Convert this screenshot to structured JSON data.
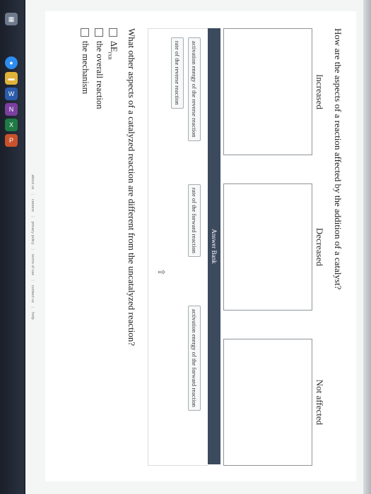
{
  "question1": "How are the aspects of a reaction affected by the addition of a catalyst?",
  "columns": [
    "Increased",
    "Decreased",
    "Not affected"
  ],
  "answer_bank": {
    "title": "Answer Bank",
    "items": [
      "activation energy of the reverse reaction",
      "rate of the forward reaction",
      "activation energy of the forward reaction",
      "rate of the reverse reaction"
    ]
  },
  "question2": "What other aspects of a catalyzed reaction are different from the uncatalyzed reaction?",
  "options": [
    {
      "main": "ΔE",
      "sub": "rxn"
    },
    {
      "main": "the overall reaction"
    },
    {
      "main": "the mechanism"
    }
  ],
  "footer": [
    "about us",
    "careers",
    "privacy policy",
    "terms of use",
    "contact us",
    "help"
  ],
  "taskbar": {
    "icons": [
      "tile-icon",
      "chrome-icon",
      "folder-icon",
      "word-icon",
      "onenote-icon",
      "excel-icon",
      "powerpoint-icon"
    ]
  }
}
